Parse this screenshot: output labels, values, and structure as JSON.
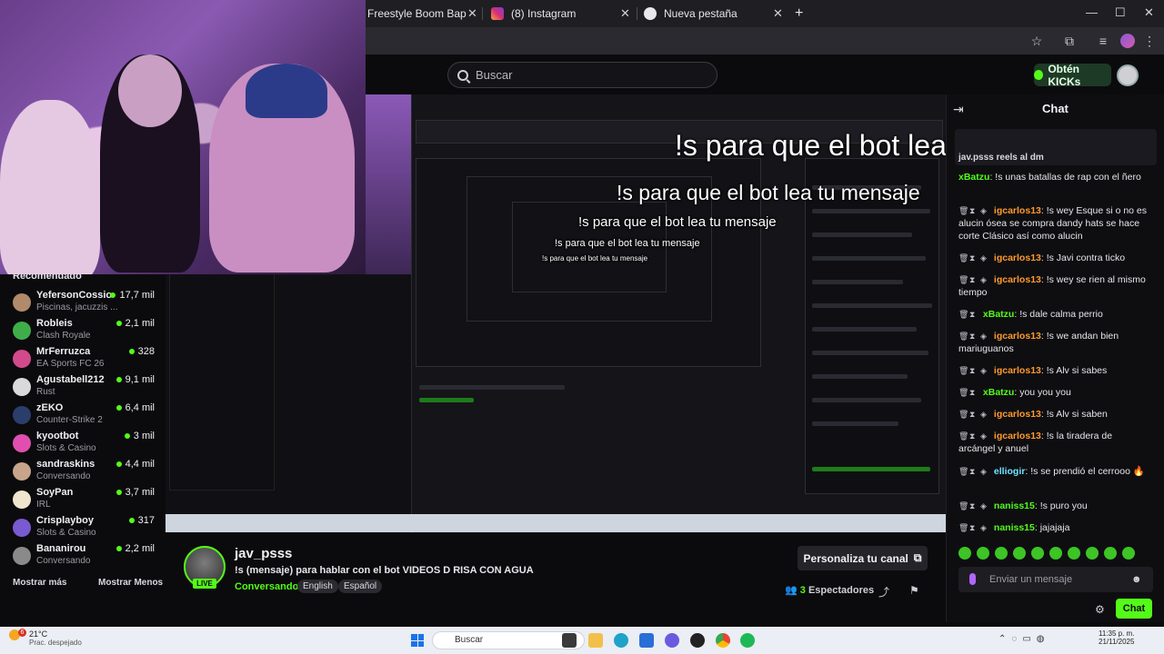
{
  "browser": {
    "tabs": [
      {
        "label": "Freestyle Boom Bap Beat | \"M"
      },
      {
        "label": "(8) Instagram"
      },
      {
        "label": "Nueva pestaña"
      }
    ],
    "new_tab": "+",
    "window": {
      "minimize": "—",
      "maximize": "☐",
      "close": "✕"
    }
  },
  "header": {
    "search_placeholder": "Buscar",
    "kicks_button": "Obtén KICKs"
  },
  "overlays": [
    {
      "text": "!s para que el bot lea tu mensaje"
    },
    {
      "text": "!s para que el bot lea tu mensaje"
    },
    {
      "text": "!s para que el bot lea tu mensaje"
    },
    {
      "text": "!s para que el bot lea tu mensaje"
    },
    {
      "text": "!s para que el bot lea tu mensaje"
    }
  ],
  "sidebar": {
    "title": "Recomendado",
    "items": [
      {
        "name": "YefersonCossio",
        "category": "Piscinas, jacuzzis ...",
        "viewers": "17,7 mil",
        "color": "#b08a6a"
      },
      {
        "name": "Robleis",
        "category": "Clash Royale",
        "viewers": "2,1 mil",
        "color": "#3fae4a"
      },
      {
        "name": "MrFerruzca",
        "category": "EA Sports FC 26",
        "viewers": "328",
        "color": "#d24a8c"
      },
      {
        "name": "Agustabell212",
        "category": "Rust",
        "viewers": "9,1 mil",
        "color": "#d9d9d9"
      },
      {
        "name": "zEKO",
        "category": "Counter-Strike 2",
        "viewers": "6,4 mil",
        "color": "#2b3e6b"
      },
      {
        "name": "kyootbot",
        "category": "Slots & Casino",
        "viewers": "3 mil",
        "color": "#e04fb0"
      },
      {
        "name": "sandraskins",
        "category": "Conversando",
        "viewers": "4,4 mil",
        "color": "#c8a48a"
      },
      {
        "name": "SoyPan",
        "category": "IRL",
        "viewers": "3,7 mil",
        "color": "#f0e6cf"
      },
      {
        "name": "Crisplayboy",
        "category": "Slots & Casino",
        "viewers": "317",
        "color": "#7a5ad0"
      },
      {
        "name": "Bananirou",
        "category": "Conversando",
        "viewers": "2,2 mil",
        "color": "#8a8a8a"
      }
    ],
    "show_more": "Mostrar más",
    "show_less": "Mostrar Menos"
  },
  "stream": {
    "streamer": "jav_psss",
    "live": "LIVE",
    "title": "!s (mensaje) para hablar con el bot VIDEOS D RISA CON AGUA",
    "category": "Conversando",
    "tags": [
      "English",
      "Español"
    ],
    "customize_button": "Personaliza tu canal",
    "viewers_count": "3",
    "viewers_label": "Espectadores"
  },
  "chat": {
    "title": "Chat",
    "pinned": "jav.psss reels al dm",
    "messages": [
      {
        "user": "igcarlos13",
        "text": "!s wey Esque si o no es alucin ósea se compra dandy hats se hace corte Clásico así como alucin",
        "color": "#ff9a2e"
      },
      {
        "user": "igcarlos13",
        "text": "!s Javi contra ticko",
        "color": "#ff9a2e"
      },
      {
        "user": "igcarlos13",
        "text": "!s wey se rien al mismo tiempo",
        "color": "#ff9a2e"
      },
      {
        "user": "xBatzu",
        "text": "!s dale calma perrio",
        "color": "#53fc18"
      },
      {
        "user": "igcarlos13",
        "text": "!s we andan bien mariuguanos",
        "color": "#ff9a2e"
      },
      {
        "user": "igcarlos13",
        "text": "!s Alv si sabes",
        "color": "#ff9a2e"
      },
      {
        "user": "xBatzu",
        "text": "you you you",
        "color": "#53fc18"
      },
      {
        "user": "igcarlos13",
        "text": "!s Alv si saben",
        "color": "#ff9a2e"
      },
      {
        "user": "igcarlos13",
        "text": "!s la tiradera de arcángel y anuel",
        "color": "#ff9a2e"
      },
      {
        "user": "elliogir",
        "text": "!s se prendió el cerrooo 🔥",
        "color": "#6fe3ff"
      },
      {
        "user": "naniss15",
        "text": "!s puro you",
        "color": "#53fc18"
      },
      {
        "user": "naniss15",
        "text": "jajajaja",
        "color": "#53fc18"
      }
    ],
    "top_partial": {
      "user": "xBatzu",
      "text": "!s unas batallas de rap con el ñero"
    },
    "input_placeholder": "Enviar un mensaje",
    "send_button": "Chat"
  },
  "taskbar": {
    "temperature": "21°C",
    "weather": "Prac. despejado",
    "search": "Buscar",
    "time": "11:35 p. m.",
    "date": "21/11/2025",
    "alert_badge": "6"
  },
  "colors": {
    "accent": "#53fc18",
    "background": "#0b0b0d"
  }
}
